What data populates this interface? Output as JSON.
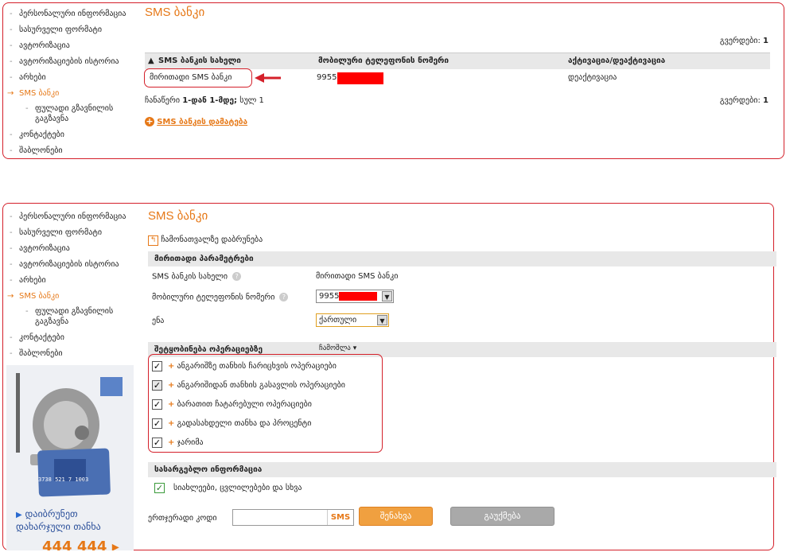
{
  "colors": {
    "accent": "#e67817",
    "highlight": "#d4202a",
    "redact": "#ff0000"
  },
  "sidebar": {
    "items": [
      "პერსონალური ინფორმაცია",
      "სასურველი ფორმატი",
      "ავტორიზაცია",
      "ავტორიზაციების ისტორია",
      "არხები",
      "SMS ბანკი",
      "ფულადი გზავნილის გაგზავნა",
      "კონტაქტები",
      "შაბლონები"
    ]
  },
  "list_view": {
    "title": "SMS ბანკი",
    "pages_label": "გვერდები:",
    "pages_value": "1",
    "columns": [
      "SMS ბანკის სახელი",
      "მობილური ტელეფონის ნომერი",
      "აქტივაცია/დეაქტივაცია"
    ],
    "rows": [
      {
        "name": "მირითადი SMS ბანკი",
        "phone": "9955",
        "status": "დეაქტივაცია"
      }
    ],
    "record_summary_prefix": "ჩანაწერი",
    "record_range": "1-დან 1-მდე;",
    "record_total": "სულ 1",
    "add_link": "SMS ბანკის დამატება"
  },
  "edit_view": {
    "title": "SMS ბანკი",
    "back_link": "ჩამონათვალზე დაბრუნება",
    "main_params_header": "მირითადი პარამეტრები",
    "name_label": "SMS ბანკის სახელი",
    "name_value": "მირითადი SMS ბანკი",
    "phone_label": "მობილური ტელეფონის ნომერი",
    "phone_value": "9955",
    "language_label": "ენა",
    "language_value": "ქართული",
    "notify_header": "შეტყობინება ოპერაციებზე",
    "notify_toggle": "ჩამოშლა",
    "operations": [
      "ანგარიშზე თანხის ჩარიცხვის ოპერაციები",
      "ანგარიშიდან თანხის გასავლის ოპერაციები",
      "ბარათით ჩატარებული ოპერაციები",
      "გადასახდელი თანხა და პროცენტი",
      "ჯარიმა"
    ],
    "info_header": "სასარგებლო ინფორმაცია",
    "info_item": "სიახლეები, ცვლილებები და სხვა",
    "otp_label": "ერთჯერადი კოდი",
    "sms_button": "SMS",
    "save_button": "შენახვა",
    "cancel_button": "გაუქმება"
  },
  "promo": {
    "text_line1": "დაიბრუნეთ",
    "text_line2": "დახარჯული თანხა",
    "phone": "444 444",
    "card_number": "3738 521 7 1003"
  }
}
